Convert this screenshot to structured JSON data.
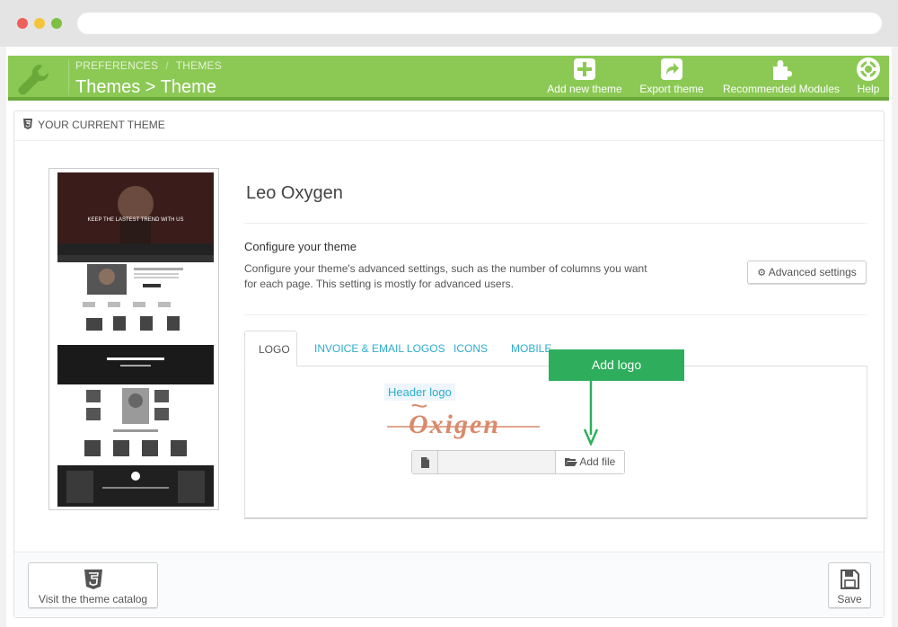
{
  "header": {
    "breadcrumb": [
      "PREFERENCES",
      "THEMES"
    ],
    "breadcrumb_separator": "/",
    "title": "Themes > Theme",
    "actions": [
      {
        "label": "Add new theme",
        "icon": "plus-square-icon"
      },
      {
        "label": "Export theme",
        "icon": "share-icon"
      },
      {
        "label": "Recommended Modules",
        "icon": "puzzle-icon"
      },
      {
        "label": "Help",
        "icon": "lifebuoy-icon"
      }
    ]
  },
  "panel": {
    "heading": "YOUR CURRENT THEME",
    "theme_name": "Leo Oxygen",
    "configure_title": "Configure your theme",
    "configure_desc": "Configure your theme's advanced settings, such as the number of columns you want for each page. This setting is mostly for advanced users.",
    "advanced_button": "Advanced settings",
    "preview": {
      "hero_text": "KEEP THE LASTEST TREND WITH US"
    },
    "tabs": [
      {
        "label": "LOGO",
        "active": true
      },
      {
        "label": "INVOICE & EMAIL LOGOS",
        "active": false
      },
      {
        "label": "ICONS",
        "active": false
      },
      {
        "label": "MOBILE",
        "active": false
      }
    ],
    "logo_tab": {
      "header_logo_label": "Header logo",
      "logo_text": "Oxigen",
      "file_value": "",
      "add_file_button": "Add file"
    }
  },
  "callout": {
    "label": "Add logo"
  },
  "footer": {
    "catalog_button": "Visit the theme catalog",
    "save_button": "Save"
  },
  "colors": {
    "toolbar": "#8bc954",
    "link": "#2eacce",
    "callout": "#2eae5c",
    "logo": "#d98a6a"
  }
}
